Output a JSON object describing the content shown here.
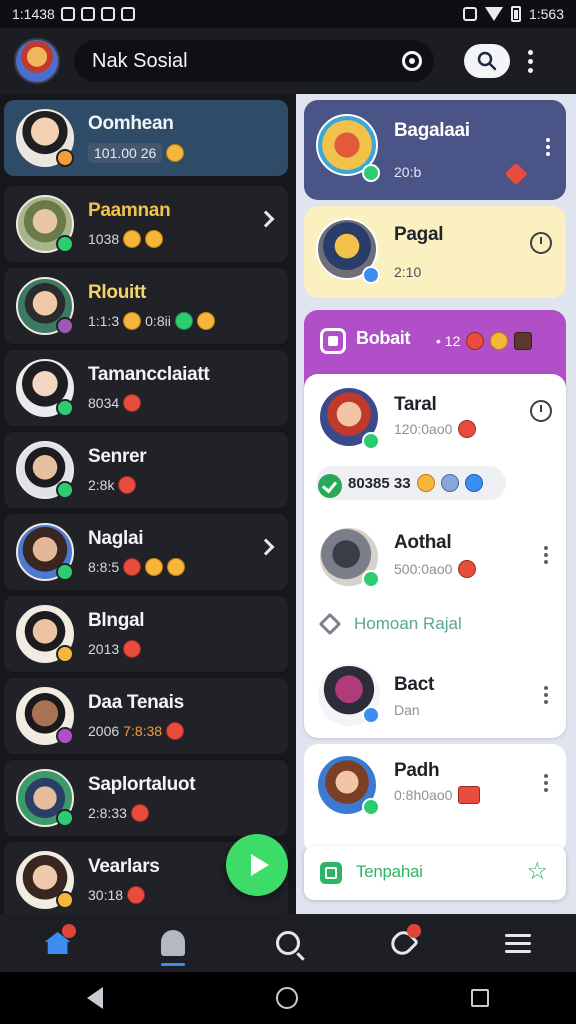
{
  "status_bar": {
    "time": "1:1438",
    "clock": "1:563"
  },
  "header": {
    "title": "Nak Sosial"
  },
  "left_chats": [
    {
      "name": "Oomhean",
      "meta": "101.00 26",
      "style": "active"
    },
    {
      "name": "Paamnan",
      "meta": "1038",
      "style": "gold"
    },
    {
      "name": "Rlouitt",
      "meta": "1:1:3",
      "meta2": "0:8ii",
      "style": "gold2"
    },
    {
      "name": "Tamancclaiatt",
      "meta": "8034",
      "style": ""
    },
    {
      "name": "Senrer",
      "meta": "2:8k",
      "style": ""
    },
    {
      "name": "Naglai",
      "meta": "8:8:5",
      "style": ""
    },
    {
      "name": "Blngal",
      "meta": "2013",
      "style": ""
    },
    {
      "name": "Daa Tenais",
      "meta": "2006",
      "meta2": "7:8:38",
      "style": ""
    },
    {
      "name": "Saplortaluot",
      "meta": "2:8:33",
      "style": ""
    },
    {
      "name": "Vearlars",
      "meta": "30:18",
      "style": ""
    }
  ],
  "right_cards": {
    "top": {
      "name": "Bagalaai",
      "meta": "20:b"
    },
    "yellow": {
      "name": "Pagal",
      "meta": "2:10"
    },
    "section": {
      "title": "Bobait",
      "meta": "• 12"
    },
    "item1": {
      "name": "Taral",
      "meta": "120:0ao0"
    },
    "pill": {
      "text": "80385 33"
    },
    "item2": {
      "name": "Aothal",
      "meta": "500:0ao0"
    },
    "link": {
      "text": "Homoan Rajal"
    },
    "item3": {
      "name": "Bact",
      "meta": "Dan"
    },
    "item4": {
      "name": "Padh",
      "meta": "0:8h0ao0"
    },
    "footer": {
      "text": "Tenpahai"
    }
  },
  "nav": {
    "home_badge": "",
    "heart_badge": ""
  },
  "colors": {
    "accent_blue": "#3d8df0",
    "accent_green": "#3ddc68",
    "section_purple": "#b04fc7",
    "card_yellow": "#fbf0c0"
  }
}
